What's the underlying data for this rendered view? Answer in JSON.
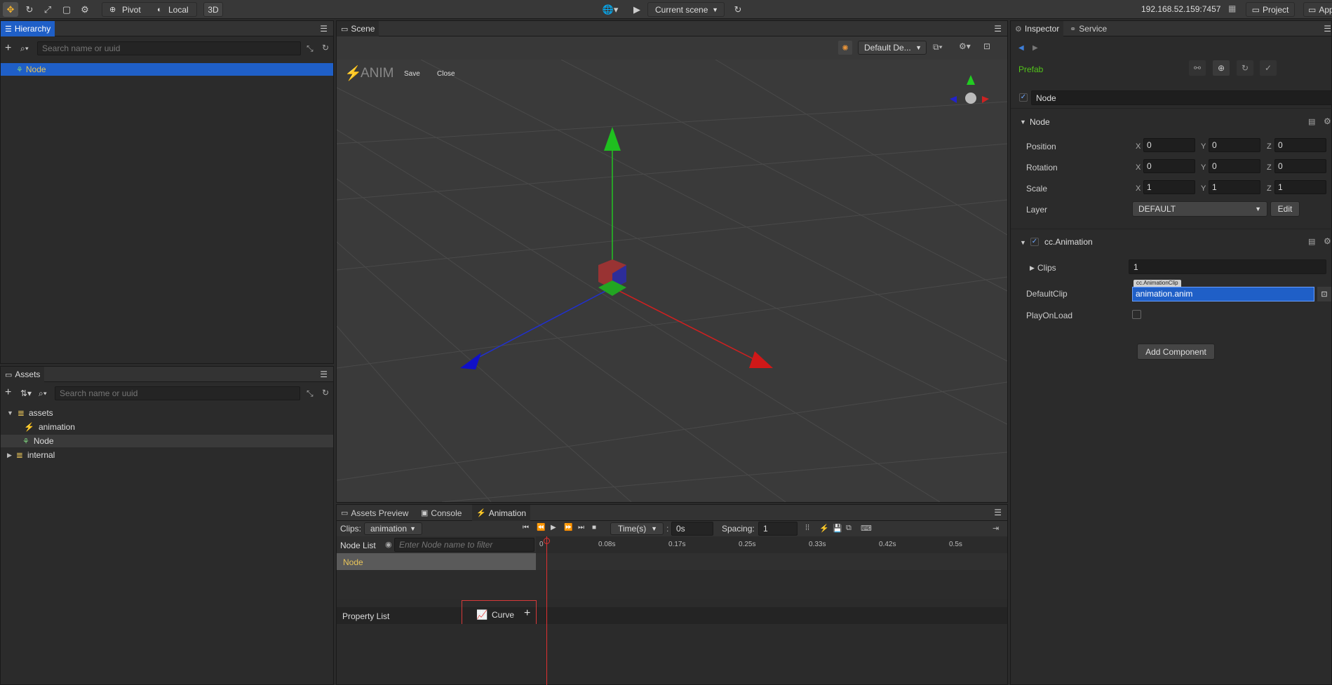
{
  "toolbar": {
    "pivot": "Pivot",
    "local": "Local",
    "mode3d": "3D",
    "scene_select": "Current scene",
    "ip": "192.168.52.159:7457",
    "project": "Project",
    "app": "App"
  },
  "hierarchy": {
    "tab": "Hierarchy",
    "search_placeholder": "Search name or uuid",
    "items": [
      {
        "label": "Node"
      }
    ]
  },
  "assets": {
    "tab": "Assets",
    "search_placeholder": "Search name or uuid",
    "tree": [
      {
        "label": "assets"
      },
      {
        "label": "animation"
      },
      {
        "label": "Node"
      },
      {
        "label": "internal"
      }
    ]
  },
  "scene": {
    "tab": "Scene",
    "anim_label": "ANIM",
    "save": "Save",
    "close": "Close",
    "camera_select": "Default De..."
  },
  "bottom": {
    "tabs": [
      "Assets Preview",
      "Console",
      "Animation"
    ]
  },
  "animation": {
    "clips_label": "Clips:",
    "clip": "animation",
    "time_mode": "Time(s)",
    "time_value": "0s",
    "spacing_label": "Spacing:",
    "spacing_value": "1",
    "node_list": "Node List",
    "node_filter_placeholder": "Enter Node name to filter",
    "node_row": "Node",
    "property_list": "Property List",
    "curve": "Curve",
    "ticks": [
      "0",
      "0.08s",
      "0.17s",
      "0.25s",
      "0.33s",
      "0.42s",
      "0.5s"
    ]
  },
  "inspector": {
    "tabs": [
      "Inspector",
      "Service"
    ],
    "prefab": "Prefab",
    "node_name": "Node",
    "node_section": "Node",
    "position_label": "Position",
    "rotation_label": "Rotation",
    "scale_label": "Scale",
    "layer_label": "Layer",
    "position": [
      "0",
      "0",
      "0"
    ],
    "rotation": [
      "0",
      "0",
      "0"
    ],
    "scale": [
      "1",
      "1",
      "1"
    ],
    "axes": [
      "X",
      "Y",
      "Z"
    ],
    "layer_value": "DEFAULT",
    "edit": "Edit",
    "anim_component": "cc.Animation",
    "clips_label": "Clips",
    "clips_value": "1",
    "default_clip_label": "DefaultClip",
    "default_clip_type": "cc.AnimationClip",
    "default_clip_value": "animation.anim",
    "play_on_load_label": "PlayOnLoad",
    "add_component": "Add Component"
  },
  "colors": {
    "accent": "#1f5fc7",
    "prefab": "#52c41a",
    "node_yellow": "#e8c45a"
  }
}
